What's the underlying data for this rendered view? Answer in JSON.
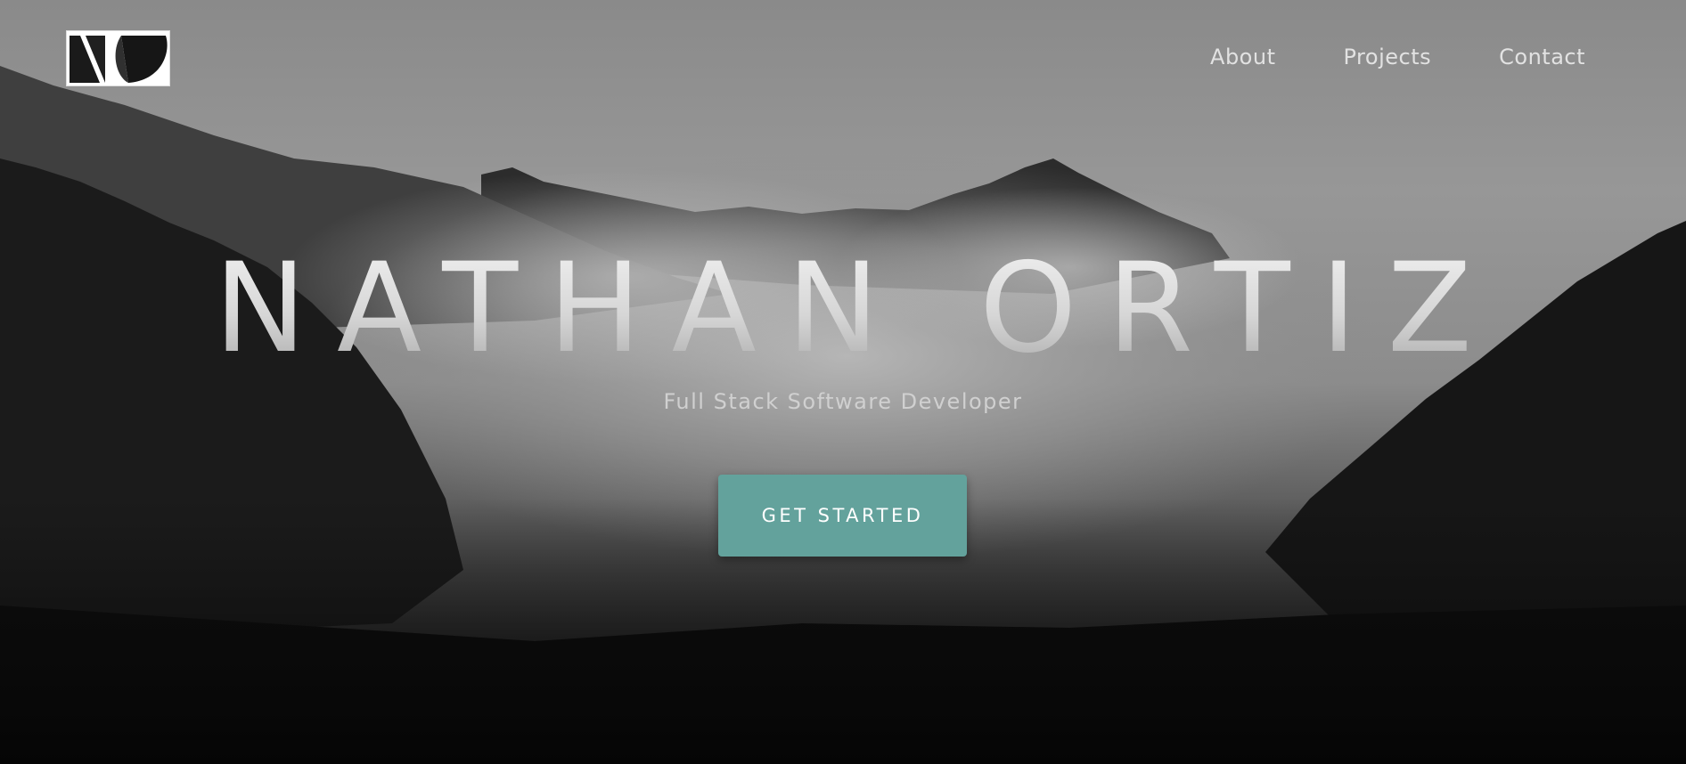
{
  "site": {
    "logo_icon": "no-monogram-logo",
    "nav": {
      "about": "About",
      "projects": "Projects",
      "contact": "Contact"
    }
  },
  "hero": {
    "name": "NATHAN ORTIZ",
    "tagline": "Full Stack Software Developer",
    "cta_label": "GET STARTED",
    "background": "misty-forested-mountains-grayscale"
  },
  "colors": {
    "accent": "#63a29c",
    "nav_text": "#e2e2e2",
    "title_text": "#d8d8d8"
  }
}
